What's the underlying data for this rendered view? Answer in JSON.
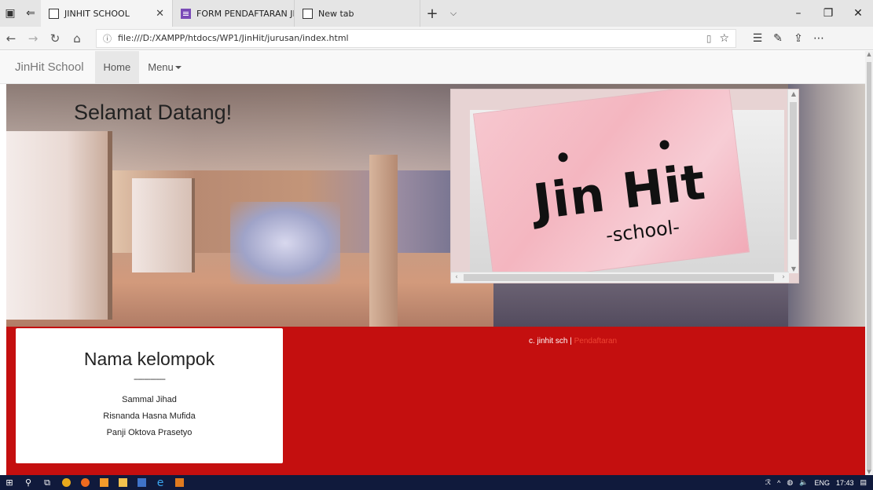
{
  "browser": {
    "tabs": [
      {
        "label": "JINHIT SCHOOL",
        "active": true
      },
      {
        "label": "FORM PENDAFTARAN JINH",
        "active": false
      },
      {
        "label": "New tab",
        "active": false
      }
    ],
    "url": "file:///D:/XAMPP/htdocs/WP1/JinHit/jurusan/index.html"
  },
  "navbar": {
    "brand": "JinHit School",
    "home": "Home",
    "menu": "Menu"
  },
  "hero": {
    "title": "Selamat Datang!",
    "logo_main": "Jin Hit",
    "logo_sub": "-school-"
  },
  "group": {
    "title": "Nama kelompok",
    "separator": "---------------",
    "members": [
      "Sammal Jihad",
      "Risnanda Hasna Mufida",
      "Panji Oktova Prasetyo"
    ]
  },
  "footer": {
    "copyright": "c. jinhit sch |",
    "link": "Pendaftaran"
  },
  "taskbar": {
    "lang": "ENG",
    "time": "17:43"
  },
  "colors": {
    "footer_bg": "#c40f0f",
    "taskbar_bg": "#101a3c",
    "card_pink": "#f4b6c0"
  }
}
